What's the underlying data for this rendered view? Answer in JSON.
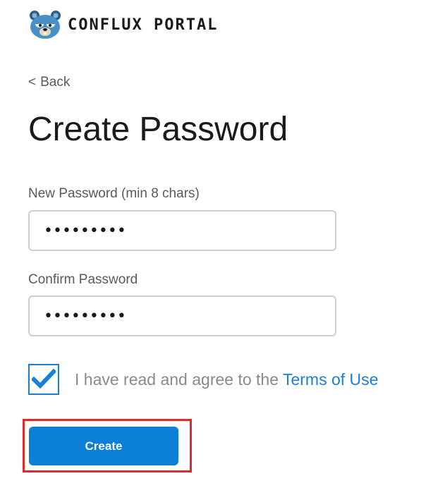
{
  "header": {
    "logo_text": "CONFLUX PORTAL",
    "mascot_icon": "bear-mascot-icon"
  },
  "back_link": {
    "chevron": "<",
    "label": "Back"
  },
  "page_title": "Create Password",
  "new_password": {
    "label": "New Password (min 8 chars)",
    "value": "•••••••••"
  },
  "confirm_password": {
    "label": "Confirm Password",
    "value": "•••••••••"
  },
  "terms": {
    "checked": true,
    "text": "I have read and agree to the ",
    "link_text": "Terms of Use"
  },
  "create_button": {
    "label": "Create"
  },
  "colors": {
    "accent": "#0c7fd8",
    "highlight": "#e02a2a",
    "text_primary": "#1a1a1a",
    "text_secondary": "#5a5a5a"
  }
}
